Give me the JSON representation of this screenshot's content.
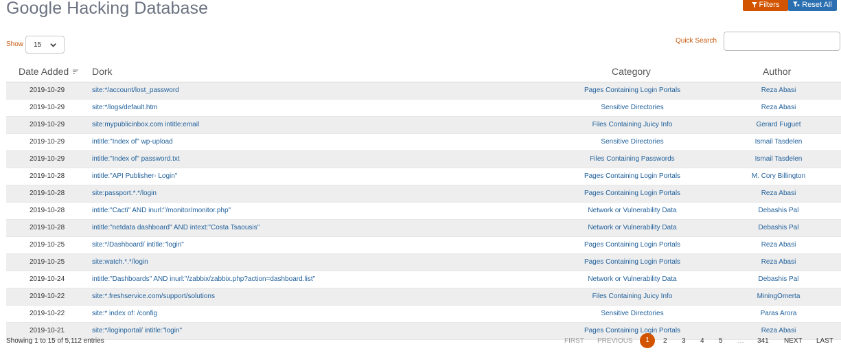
{
  "page": {
    "title": "Google Hacking Database"
  },
  "toolbar": {
    "filters_label": "Filters",
    "reset_label": "Reset All"
  },
  "controls": {
    "show_label": "Show",
    "show_value": "15",
    "quick_search_label": "Quick Search",
    "quick_search_value": ""
  },
  "table": {
    "columns": [
      "Date Added",
      "Dork",
      "Category",
      "Author"
    ],
    "rows": [
      {
        "date": "2019-10-29",
        "dork": "site:*/account/lost_password",
        "category": "Pages Containing Login Portals",
        "author": "Reza Abasi"
      },
      {
        "date": "2019-10-29",
        "dork": "site:*/logs/default.htm",
        "category": "Sensitive Directories",
        "author": "Reza Abasi"
      },
      {
        "date": "2019-10-29",
        "dork": "site:mypublicinbox.com intitle:email",
        "category": "Files Containing Juicy Info",
        "author": "Gerard Fuguet"
      },
      {
        "date": "2019-10-29",
        "dork": "intitle:\"Index of\" wp-upload",
        "category": "Sensitive Directories",
        "author": "Ismail Tasdelen"
      },
      {
        "date": "2019-10-29",
        "dork": "intitle:\"Index of\" password.txt",
        "category": "Files Containing Passwords",
        "author": "Ismail Tasdelen"
      },
      {
        "date": "2019-10-28",
        "dork": "intitle:\"API Publisher- Login\"",
        "category": "Pages Containing Login Portals",
        "author": "M. Cory Billington"
      },
      {
        "date": "2019-10-28",
        "dork": "site:passport.*.*/login",
        "category": "Pages Containing Login Portals",
        "author": "Reza Abasi"
      },
      {
        "date": "2019-10-28",
        "dork": "intitle:\"Cacti\" AND inurl:\"/monitor/monitor.php\"",
        "category": "Network or Vulnerability Data",
        "author": "Debashis Pal"
      },
      {
        "date": "2019-10-28",
        "dork": "intitle:\"netdata dashboard\" AND intext:\"Costa Tsaousis\"",
        "category": "Network or Vulnerability Data",
        "author": "Debashis Pal"
      },
      {
        "date": "2019-10-25",
        "dork": "site:*/Dashboard/ intitle:\"login\"",
        "category": "Pages Containing Login Portals",
        "author": "Reza Abasi"
      },
      {
        "date": "2019-10-25",
        "dork": "site:watch.*.*/login",
        "category": "Pages Containing Login Portals",
        "author": "Reza Abasi"
      },
      {
        "date": "2019-10-24",
        "dork": "intitle:\"Dashboards\" AND inurl:\"/zabbix/zabbix.php?action=dashboard.list\"",
        "category": "Network or Vulnerability Data",
        "author": "Debashis Pal"
      },
      {
        "date": "2019-10-22",
        "dork": "site:*.freshservice.com/support/solutions",
        "category": "Files Containing Juicy Info",
        "author": "MiningOmerta"
      },
      {
        "date": "2019-10-22",
        "dork": "site:* index of: /config",
        "category": "Sensitive Directories",
        "author": "Paras Arora"
      },
      {
        "date": "2019-10-21",
        "dork": "site:*/loginportal/ intitle:\"login\"",
        "category": "Pages Containing Login Portals",
        "author": "Reza Abasi"
      }
    ]
  },
  "footer": {
    "info": "Showing 1 to 15 of 5,112 entries",
    "pagination": {
      "first": "FIRST",
      "previous": "PREVIOUS",
      "current": "1",
      "pages": [
        "2",
        "3",
        "4",
        "5"
      ],
      "ellipsis": "…",
      "last_page": "341",
      "next": "NEXT",
      "last": "LAST"
    }
  },
  "colors": {
    "accent": "#d35400",
    "reset_button": "#2a6fb0",
    "link": "#1f5f9a",
    "stripe": "#eeeeee"
  }
}
